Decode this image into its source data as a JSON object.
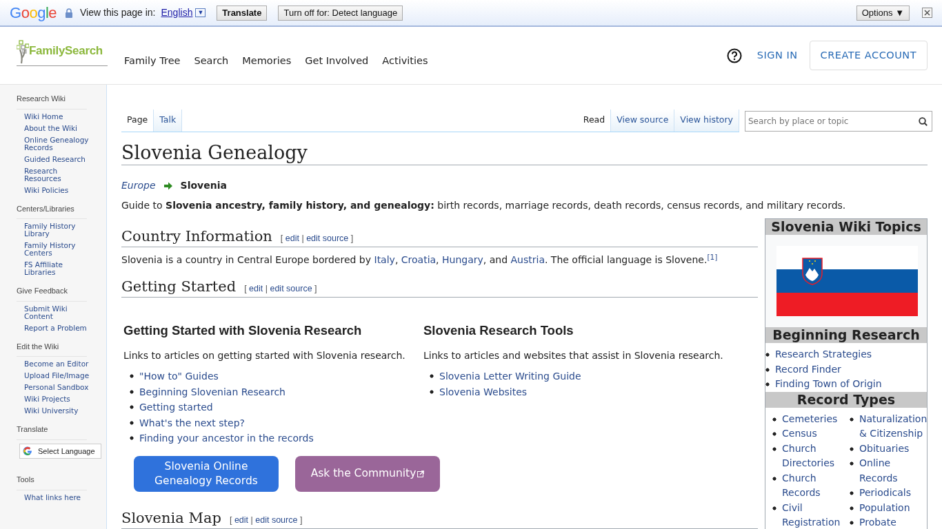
{
  "translate_bar": {
    "logo": "Google",
    "label": "View this page in:",
    "language": "English",
    "language_caret": "▼",
    "buttons": [
      "Translate",
      "Turn off for: Detect language"
    ],
    "options": "Options ▼"
  },
  "header": {
    "brand": "FamilySearch",
    "nav": [
      "Family Tree",
      "Search",
      "Memories",
      "Get Involved",
      "Activities"
    ],
    "sign_in": "SIGN IN",
    "create_account": "CREATE ACCOUNT"
  },
  "sidebar": {
    "sections": [
      {
        "title": "Research Wiki",
        "kind": "links",
        "items": [
          "Wiki Home",
          "About the Wiki",
          "Online Genealogy Records",
          "Guided Research",
          "Research Resources",
          "Wiki Policies"
        ]
      },
      {
        "title": "Centers/Libraries",
        "kind": "links",
        "items": [
          "Family History Library",
          "Family History Centers",
          "FS Affiliate Libraries"
        ]
      },
      {
        "title": "Give Feedback",
        "kind": "links",
        "items": [
          "Submit Wiki Content",
          "Report a Problem"
        ]
      },
      {
        "title": "Edit the Wiki",
        "kind": "links",
        "items": [
          "Become an Editor",
          "Upload File/Image",
          "Personal Sandbox",
          "Wiki Projects",
          "Wiki University"
        ]
      },
      {
        "title": "Translate",
        "kind": "language",
        "items": [
          "Select Language"
        ]
      },
      {
        "title": "Tools",
        "kind": "links",
        "items": [
          "What links here"
        ]
      }
    ]
  },
  "page_tabs": [
    {
      "label": "Page",
      "selected": true
    },
    {
      "label": "Talk",
      "selected": false
    }
  ],
  "view_tabs": [
    {
      "label": "Read",
      "selected": true
    },
    {
      "label": "View source",
      "selected": false
    },
    {
      "label": "View history",
      "selected": false
    }
  ],
  "search": {
    "placeholder": "Search by place or topic"
  },
  "article": {
    "title": "Slovenia Genealogy",
    "breadcrumb": {
      "parent": "Europe",
      "current": "Slovenia"
    },
    "intro": "Guide to **Slovenia ancestry, family history, and genealogy:** birth records, marriage records, death records, census records, and military records.",
    "sections": [
      {
        "heading": "Country Information",
        "edit": {
          "open": "[",
          "links": [
            "edit",
            "edit source"
          ],
          "sep": "|",
          "close": "]"
        },
        "kind": "paragraph",
        "parts": [
          {
            "text": "Slovenia is a country in Central Europe bordered by "
          },
          {
            "link": "Italy"
          },
          {
            "text": ", "
          },
          {
            "link": "Croatia"
          },
          {
            "text": ", "
          },
          {
            "link": "Hungary"
          },
          {
            "text": ", and "
          },
          {
            "link": "Austria"
          },
          {
            "text": ". The official language is Slovene."
          },
          {
            "ref": "[1]"
          }
        ]
      },
      {
        "heading": "Getting Started",
        "edit": {
          "open": "[",
          "links": [
            "edit",
            "edit source"
          ],
          "sep": "|",
          "close": "]"
        },
        "kind": "columns",
        "columns": [
          {
            "title": "Getting Started with Slovenia Research",
            "description": "Links to articles on getting started with Slovenia research.",
            "links": [
              "\"How to\" Guides",
              "Beginning Slovenian Research",
              "Getting started",
              "What's the next step?",
              "Finding your ancestor in the records"
            ]
          },
          {
            "title": "Slovenia Research Tools",
            "description": "Links to articles and websites that assist in Slovenia research.",
            "links": [
              "Slovenia Letter Writing Guide",
              "Slovenia Websites"
            ]
          }
        ],
        "buttons": [
          {
            "label": "Slovenia Online Genealogy Records",
            "color": "#2f72dc",
            "external": false
          },
          {
            "label": "Ask the Community",
            "color": "#9a6699",
            "external": true
          }
        ]
      },
      {
        "heading": "Slovenia Map",
        "edit": {
          "open": "[",
          "links": [
            "edit",
            "edit source"
          ],
          "sep": "|",
          "close": "]"
        },
        "kind": "empty"
      }
    ]
  },
  "infobox": {
    "title": "Slovenia Wiki Topics",
    "beginning": {
      "heading": "Beginning Research",
      "links": [
        "Research Strategies",
        "Record Finder",
        "Finding Town of Origin"
      ]
    },
    "record_types": {
      "heading": "Record Types",
      "columns": [
        [
          "Cemeteries",
          "Census",
          "Church Directories",
          "Church Records",
          "Civil Registration"
        ],
        [
          "Naturalization & Citizenship",
          "Obituaries",
          "Online Records",
          "Periodicals",
          "Population",
          "Probate"
        ]
      ]
    }
  }
}
